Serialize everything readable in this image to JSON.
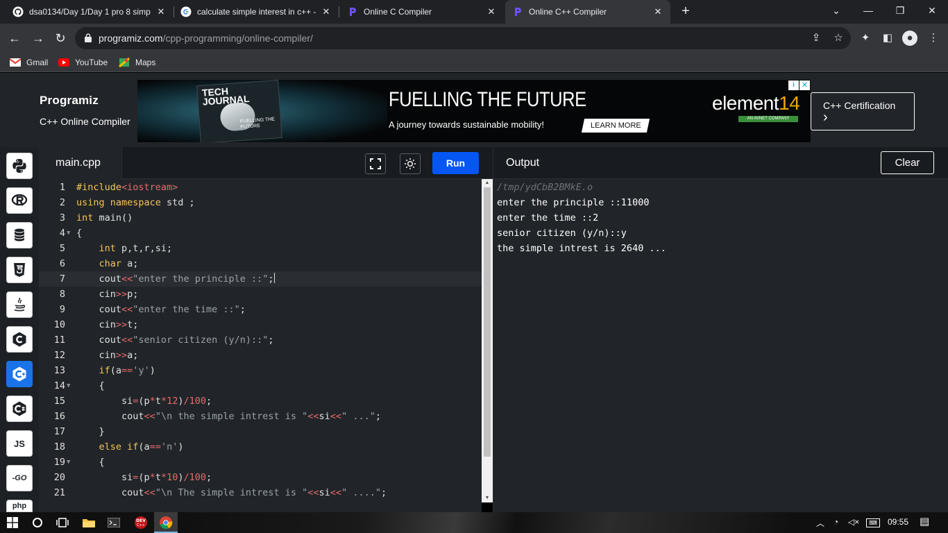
{
  "browser": {
    "tabs": [
      {
        "title": "dsa0134/Day 1/Day 1 pro 8 simp",
        "icon": "github-icon",
        "active": false
      },
      {
        "title": "calculate simple interest in c++ -",
        "icon": "google-icon",
        "active": false
      },
      {
        "title": "Online C Compiler",
        "icon": "programiz-icon",
        "active": false
      },
      {
        "title": "Online C++ Compiler",
        "icon": "programiz-icon",
        "active": true
      }
    ],
    "new_tab_label": "+",
    "url_host": "programiz.com",
    "url_path": "/cpp-programming/online-compiler/",
    "bookmarks": [
      {
        "label": "Gmail",
        "icon": "gmail-icon"
      },
      {
        "label": "YouTube",
        "icon": "youtube-icon"
      },
      {
        "label": "Maps",
        "icon": "maps-icon"
      }
    ]
  },
  "site": {
    "logo": "Programiz",
    "subtitle": "C++ Online Compiler",
    "certification": "C++ Certification",
    "certification_arrow": "›"
  },
  "ad": {
    "magazine_title": "TECH JOURNAL",
    "magazine_caption": "FUELLING THE FUTURE",
    "headline": "FUELLING THE FUTURE",
    "text": "A journey towards sustainable mobility!",
    "button": "LEARN MORE",
    "brand_word": "element",
    "brand_num": "14",
    "brand_sub": "AN AVNET COMPANY"
  },
  "rail": [
    {
      "name": "python",
      "label": ""
    },
    {
      "name": "r",
      "label": ""
    },
    {
      "name": "sql",
      "label": ""
    },
    {
      "name": "html",
      "label": ""
    },
    {
      "name": "java",
      "label": ""
    },
    {
      "name": "c",
      "label": ""
    },
    {
      "name": "cpp",
      "label": "",
      "active": true
    },
    {
      "name": "csharp",
      "label": ""
    },
    {
      "name": "js",
      "label": "JS"
    },
    {
      "name": "go",
      "label": "-GO"
    },
    {
      "name": "php",
      "label": "php"
    }
  ],
  "editor": {
    "file_name": "main.cpp",
    "run_label": "Run",
    "current_line": 7,
    "lines": [
      {
        "n": "1",
        "fold": ""
      },
      {
        "n": "2",
        "fold": ""
      },
      {
        "n": "3",
        "fold": ""
      },
      {
        "n": "4",
        "fold": "▼"
      },
      {
        "n": "5",
        "fold": ""
      },
      {
        "n": "6",
        "fold": ""
      },
      {
        "n": "7",
        "fold": ""
      },
      {
        "n": "8",
        "fold": ""
      },
      {
        "n": "9",
        "fold": ""
      },
      {
        "n": "10",
        "fold": ""
      },
      {
        "n": "11",
        "fold": ""
      },
      {
        "n": "12",
        "fold": ""
      },
      {
        "n": "13",
        "fold": ""
      },
      {
        "n": "14",
        "fold": "▼"
      },
      {
        "n": "15",
        "fold": ""
      },
      {
        "n": "16",
        "fold": ""
      },
      {
        "n": "17",
        "fold": ""
      },
      {
        "n": "18",
        "fold": ""
      },
      {
        "n": "19",
        "fold": "▼"
      },
      {
        "n": "20",
        "fold": ""
      },
      {
        "n": "21",
        "fold": ""
      }
    ],
    "code": [
      [
        {
          "t": "#include",
          "c": "k"
        },
        {
          "t": "<iostream>",
          "c": "o"
        }
      ],
      [
        {
          "t": "using namespace ",
          "c": "k"
        },
        {
          "t": "std ;",
          "c": ""
        }
      ],
      [
        {
          "t": "int ",
          "c": "k"
        },
        {
          "t": "main()",
          "c": ""
        }
      ],
      [
        {
          "t": "{",
          "c": ""
        }
      ],
      [
        {
          "t": "    ",
          "c": ""
        },
        {
          "t": "int ",
          "c": "k"
        },
        {
          "t": "p,t,r,si;",
          "c": ""
        }
      ],
      [
        {
          "t": "    ",
          "c": ""
        },
        {
          "t": "char ",
          "c": "k"
        },
        {
          "t": "a;",
          "c": ""
        }
      ],
      [
        {
          "t": "    cout",
          "c": ""
        },
        {
          "t": "<<",
          "c": "o"
        },
        {
          "t": "\"enter the principle ::\"",
          "c": "s"
        },
        {
          "t": ";",
          "c": ""
        }
      ],
      [
        {
          "t": "    cin",
          "c": ""
        },
        {
          "t": ">>",
          "c": "o"
        },
        {
          "t": "p;",
          "c": ""
        }
      ],
      [
        {
          "t": "    cout",
          "c": ""
        },
        {
          "t": "<<",
          "c": "o"
        },
        {
          "t": "\"enter the time ::\"",
          "c": "s"
        },
        {
          "t": ";",
          "c": ""
        }
      ],
      [
        {
          "t": "    cin",
          "c": ""
        },
        {
          "t": ">>",
          "c": "o"
        },
        {
          "t": "t;",
          "c": ""
        }
      ],
      [
        {
          "t": "    cout",
          "c": ""
        },
        {
          "t": "<<",
          "c": "o"
        },
        {
          "t": "\"senior citizen (y/n)::\"",
          "c": "s"
        },
        {
          "t": ";",
          "c": ""
        }
      ],
      [
        {
          "t": "    cin",
          "c": ""
        },
        {
          "t": ">>",
          "c": "o"
        },
        {
          "t": "a;",
          "c": ""
        }
      ],
      [
        {
          "t": "    ",
          "c": ""
        },
        {
          "t": "if",
          "c": "k"
        },
        {
          "t": "(a",
          "c": ""
        },
        {
          "t": "==",
          "c": "o"
        },
        {
          "t": "'y'",
          "c": "s"
        },
        {
          "t": ")",
          "c": ""
        }
      ],
      [
        {
          "t": "    {",
          "c": ""
        }
      ],
      [
        {
          "t": "        si",
          "c": ""
        },
        {
          "t": "=",
          "c": "o"
        },
        {
          "t": "(p",
          "c": ""
        },
        {
          "t": "*",
          "c": "o"
        },
        {
          "t": "t",
          "c": ""
        },
        {
          "t": "*",
          "c": "o"
        },
        {
          "t": "12",
          "c": "n"
        },
        {
          "t": ")",
          "c": ""
        },
        {
          "t": "/",
          "c": "o"
        },
        {
          "t": "100",
          "c": "n"
        },
        {
          "t": ";",
          "c": ""
        }
      ],
      [
        {
          "t": "        cout",
          "c": ""
        },
        {
          "t": "<<",
          "c": "o"
        },
        {
          "t": "\"\\n the simple intrest is \"",
          "c": "s"
        },
        {
          "t": "<<",
          "c": "o"
        },
        {
          "t": "si",
          "c": ""
        },
        {
          "t": "<<",
          "c": "o"
        },
        {
          "t": "\" ...\"",
          "c": "s"
        },
        {
          "t": ";",
          "c": ""
        }
      ],
      [
        {
          "t": "    }",
          "c": ""
        }
      ],
      [
        {
          "t": "    ",
          "c": ""
        },
        {
          "t": "else if",
          "c": "k"
        },
        {
          "t": "(a",
          "c": ""
        },
        {
          "t": "==",
          "c": "o"
        },
        {
          "t": "'n'",
          "c": "s"
        },
        {
          "t": ")",
          "c": ""
        }
      ],
      [
        {
          "t": "    {",
          "c": ""
        }
      ],
      [
        {
          "t": "        si",
          "c": ""
        },
        {
          "t": "=",
          "c": "o"
        },
        {
          "t": "(p",
          "c": ""
        },
        {
          "t": "*",
          "c": "o"
        },
        {
          "t": "t",
          "c": ""
        },
        {
          "t": "*",
          "c": "o"
        },
        {
          "t": "10",
          "c": "n"
        },
        {
          "t": ")",
          "c": ""
        },
        {
          "t": "/",
          "c": "o"
        },
        {
          "t": "100",
          "c": "n"
        },
        {
          "t": ";",
          "c": ""
        }
      ],
      [
        {
          "t": "        cout",
          "c": ""
        },
        {
          "t": "<<",
          "c": "o"
        },
        {
          "t": "\"\\n The simple intrest is \"",
          "c": "s"
        },
        {
          "t": "<<",
          "c": "o"
        },
        {
          "t": "si",
          "c": ""
        },
        {
          "t": "<<",
          "c": "o"
        },
        {
          "t": "\" ....\"",
          "c": "s"
        },
        {
          "t": ";",
          "c": ""
        }
      ]
    ]
  },
  "output": {
    "title": "Output",
    "clear_label": "Clear",
    "lines": [
      {
        "text": "/tmp/ydCbB2BMkE.o",
        "kind": "path"
      },
      {
        "text": "enter the principle ::11000",
        "kind": ""
      },
      {
        "text": "enter the time ::2",
        "kind": ""
      },
      {
        "text": "senior citizen (y/n)::y",
        "kind": ""
      },
      {
        "text": "the simple intrest is 2640 ...",
        "kind": ""
      }
    ]
  },
  "taskbar": {
    "time": "09:55",
    "apps": [
      "start-icon",
      "search-icon",
      "task-view-icon",
      "file-explorer-icon",
      "terminal-icon",
      "dev-cpp-icon",
      "chrome-icon"
    ]
  },
  "colors": {
    "run_button": "#0556f3",
    "active_rail": "#1a73e8",
    "keyword": "#f8c555",
    "operator": "#e86a6a",
    "string": "#9aa3ab"
  }
}
